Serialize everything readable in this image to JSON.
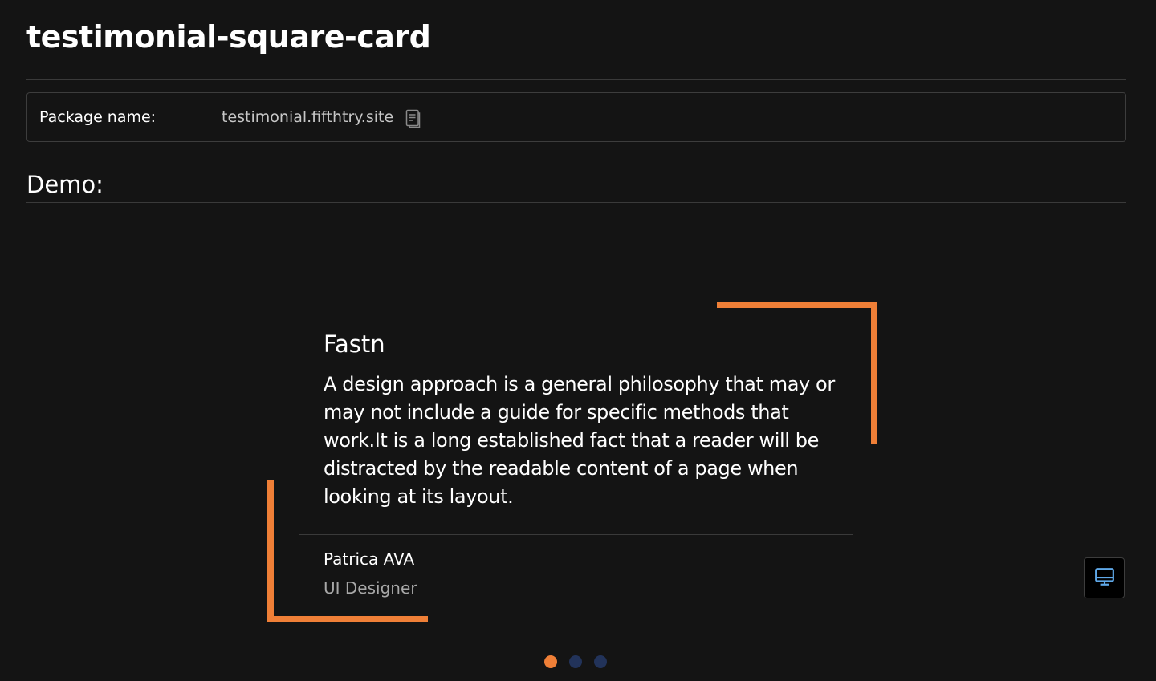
{
  "header": {
    "title": "testimonial-square-card"
  },
  "package": {
    "label": "Package name:",
    "value": "testimonial.fifthtry.site",
    "copy_icon": "copy-icon"
  },
  "demo": {
    "heading": "Demo:"
  },
  "testimonial": {
    "title": "Fastn",
    "body": "A design approach is a general philosophy that may or may not include a guide for specific methods that work.It is a long established fact that a reader will be distracted by the readable content of a page when looking at its layout.",
    "author_name": "Patrica AVA",
    "author_role": "UI Designer",
    "accent_color": "#ef7f37"
  },
  "carousel": {
    "slide_count": 3,
    "active_index": 0,
    "active_color": "#ef7f37",
    "inactive_color": "#22335a"
  },
  "device_toggle": {
    "icon": "desktop-icon",
    "icon_color": "#5fa8e8"
  },
  "colors": {
    "background": "#141414",
    "text": "#ffffff",
    "muted_text": "#a8a8a8",
    "border": "#3d3d3d"
  }
}
